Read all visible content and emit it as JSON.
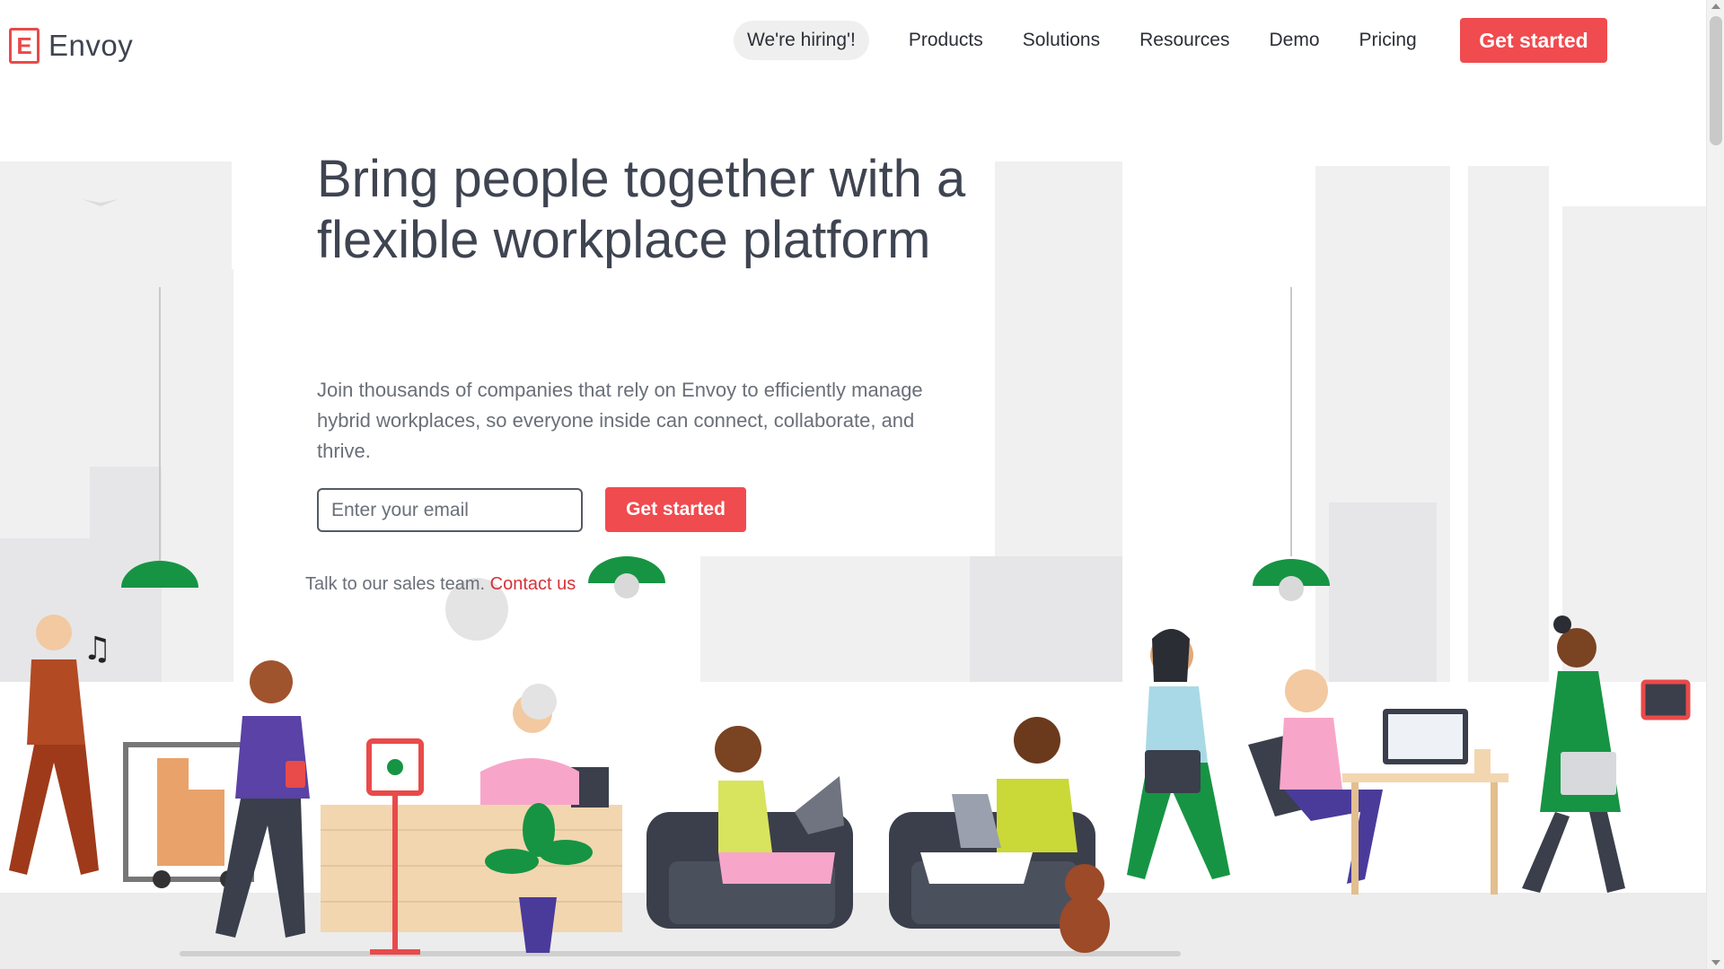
{
  "brand": {
    "name": "Envoy",
    "logo_letter": "E",
    "accent": "#f04b4f"
  },
  "nav": {
    "hiring": "We're hiring'!",
    "items": [
      "Products",
      "Solutions",
      "Resources",
      "Demo",
      "Pricing"
    ],
    "cta": "Get started"
  },
  "hero": {
    "title": "Bring people together with a flexible workplace platform",
    "subtitle": "Join thousands of companies that rely on Envoy to efficiently manage hybrid workplaces, so everyone inside can connect, collaborate, and thrive.",
    "email_placeholder": "Enter your email",
    "cta": "Get started",
    "sales_text": "Talk to our sales team.",
    "contact_link": "Contact us"
  },
  "colors": {
    "text_dark": "#3f4451",
    "text_muted": "#6a6f78",
    "building": "#efefef",
    "lamp_green": "#169443"
  }
}
